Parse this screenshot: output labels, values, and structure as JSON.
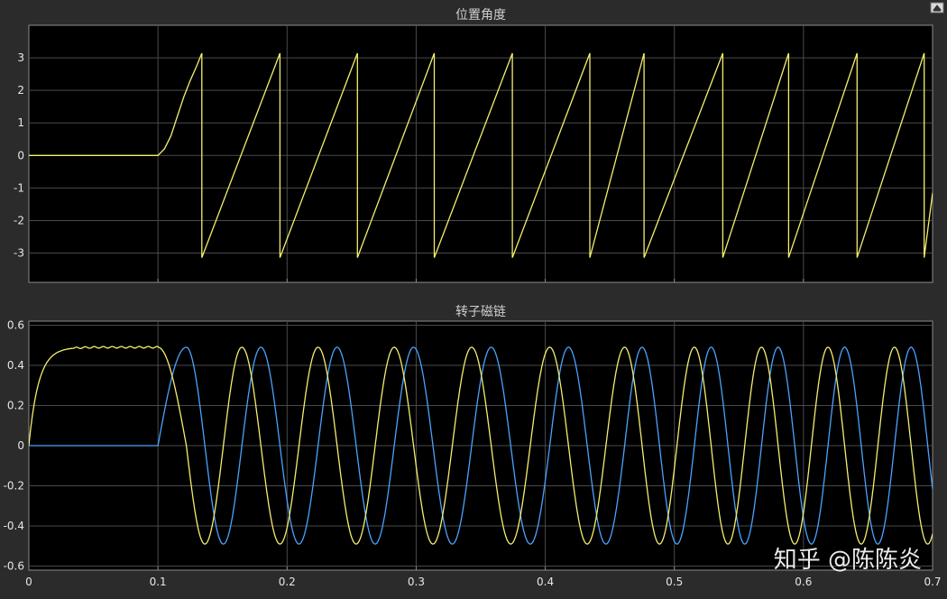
{
  "colors": {
    "figure_bg": "#2b2b2b",
    "axes_bg": "#000000",
    "grid": "#4a4a4a",
    "axis_line": "#8c8c8c",
    "tick_text": "#e6e6e6",
    "title_text": "#cfcfcf",
    "series_yellow": "#f4ef6e",
    "series_blue": "#4aa3ff",
    "watermark": "#ffffff"
  },
  "toolbar": {
    "restore_icon": "restore-axes-icon"
  },
  "watermark": "知乎 @陈陈炎",
  "chart_data": [
    {
      "type": "line",
      "title": "位置角度",
      "xlim": [
        0,
        0.7
      ],
      "ylim": [
        -3.9,
        4.0
      ],
      "yticks": [
        -3,
        -2,
        -1,
        0,
        1,
        2,
        3
      ],
      "ytick_labels": [
        "-3",
        "-2",
        "-1",
        "0",
        "1",
        "2",
        "3"
      ],
      "xticks": [
        0,
        0.1,
        0.2,
        0.3,
        0.4,
        0.5,
        0.6,
        0.7
      ],
      "grid": true,
      "series": [
        {
          "color": "#f4ef6e",
          "wrapped_angle": true,
          "x": [
            0,
            0.1,
            0.105,
            0.11,
            0.115,
            0.12,
            0.125,
            0.13,
            0.134,
            0.134,
            0.1945,
            0.1945,
            0.2545,
            0.2545,
            0.314,
            0.314,
            0.3745,
            0.3745,
            0.4345,
            0.4345,
            0.4765,
            0.4765,
            0.5375,
            0.5375,
            0.5885,
            0.5885,
            0.6415,
            0.6415,
            0.6935,
            0.6935,
            0.7
          ],
          "y": [
            0,
            0,
            0.2,
            0.6,
            1.2,
            1.8,
            2.3,
            2.75,
            3.14,
            -3.14,
            3.14,
            -3.14,
            3.14,
            -3.14,
            3.14,
            -3.14,
            3.14,
            -3.14,
            3.14,
            -3.14,
            3.14,
            -3.14,
            3.14,
            -3.14,
            3.14,
            -3.14,
            3.14,
            -3.14,
            3.14,
            -3.14,
            -1.15
          ]
        }
      ]
    },
    {
      "type": "line",
      "title": "转子磁链",
      "xlim": [
        0,
        0.7
      ],
      "ylim": [
        -0.62,
        0.62
      ],
      "yticks": [
        -0.6,
        -0.4,
        -0.2,
        0,
        0.2,
        0.4,
        0.6
      ],
      "ytick_labels": [
        "-0.6",
        "-0.4",
        "-0.2",
        "0",
        "0.2",
        "0.4",
        "0.6"
      ],
      "xticks": [
        0,
        0.1,
        0.2,
        0.3,
        0.4,
        0.5,
        0.6,
        0.7
      ],
      "xtick_labels": [
        "0",
        "0.1",
        "0.2",
        "0.3",
        "0.4",
        "0.5",
        "0.6",
        "0.7"
      ],
      "grid": true,
      "flux_magnitude": 0.49,
      "startup_end": 0.1,
      "oscillation_start": 0.1,
      "first_peak_blue": 0.122,
      "yellow_peaks_after_start": [
        0.165,
        0.224,
        0.283,
        0.343,
        0.4035,
        0.4615,
        0.5155,
        0.5675,
        0.619,
        0.6705
      ],
      "series": [
        {
          "color": "#f4ef6e",
          "shape": "cos-like"
        },
        {
          "color": "#4aa3ff",
          "shape": "sin-like"
        }
      ]
    }
  ]
}
